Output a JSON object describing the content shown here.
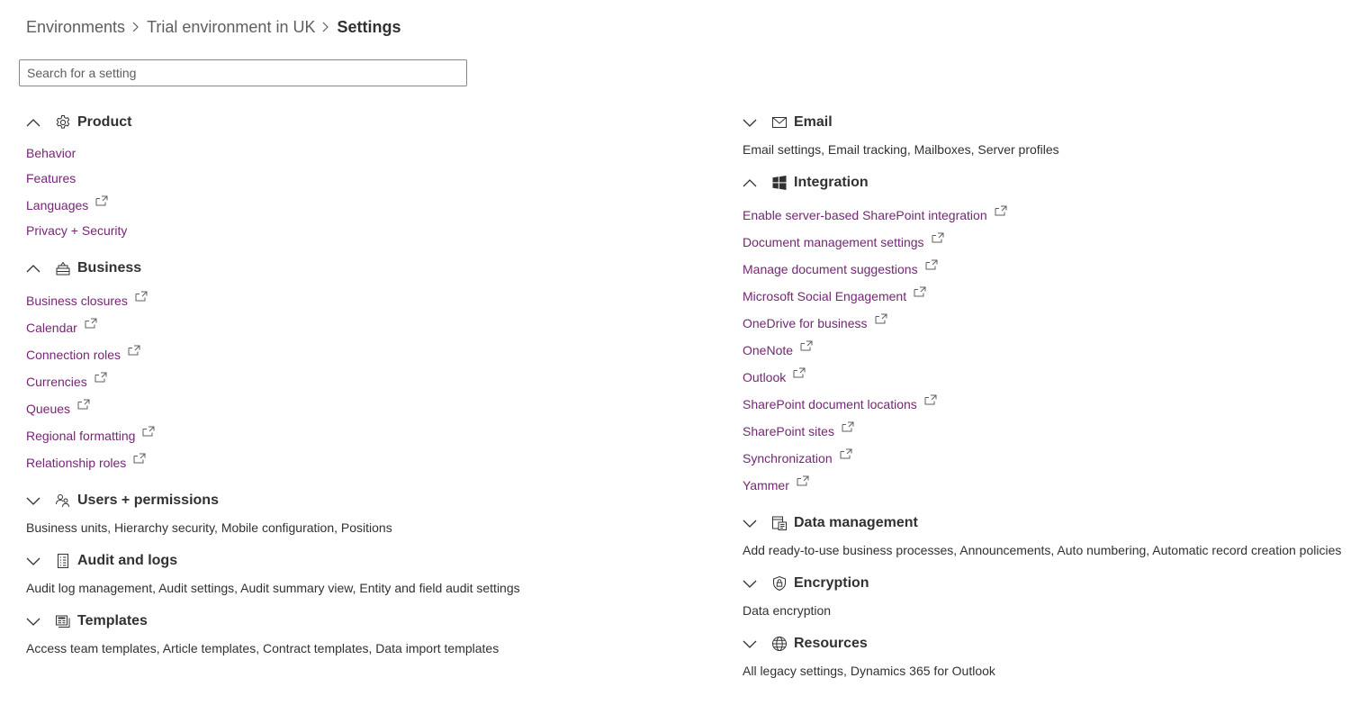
{
  "breadcrumb": {
    "items": [
      "Environments",
      "Trial environment in UK",
      "Settings"
    ]
  },
  "search": {
    "placeholder": "Search for a setting"
  },
  "left_groups": {
    "product": {
      "title": "Product",
      "icon": "gear-icon",
      "expanded": true,
      "links": [
        "Behavior",
        "Features",
        "Languages",
        "Privacy + Security"
      ],
      "external": [
        false,
        false,
        true,
        false
      ]
    },
    "business": {
      "title": "Business",
      "icon": "building-icon",
      "expanded": true,
      "links": [
        "Business closures",
        "Calendar",
        "Connection roles",
        "Currencies",
        "Queues",
        "Regional formatting",
        "Relationship roles"
      ]
    },
    "users": {
      "title": "Users + permissions",
      "icon": "people-icon",
      "expanded": false,
      "summary": "Business units, Hierarchy security, Mobile configuration, Positions"
    },
    "audit": {
      "title": "Audit and logs",
      "icon": "checklist-icon",
      "expanded": false,
      "summary": "Audit log management, Audit settings, Audit summary view, Entity and field audit settings"
    },
    "templates": {
      "title": "Templates",
      "icon": "templates-icon",
      "expanded": false,
      "summary": "Access team templates, Article templates, Contract templates, Data import templates"
    }
  },
  "right_groups": {
    "email": {
      "title": "Email",
      "icon": "mail-icon",
      "expanded": false,
      "summary": "Email settings, Email tracking, Mailboxes, Server profiles"
    },
    "integration": {
      "title": "Integration",
      "icon": "windows-icon",
      "expanded": true,
      "links": [
        "Enable server-based SharePoint integration",
        "Document management settings",
        "Manage document suggestions",
        "Microsoft Social Engagement",
        "OneDrive for business",
        "OneNote",
        "Outlook",
        "SharePoint document locations",
        "SharePoint sites",
        "Synchronization",
        "Yammer"
      ]
    },
    "data": {
      "title": "Data management",
      "icon": "data-management-icon",
      "expanded": false,
      "summary": "Add ready-to-use business processes, Announcements, Auto numbering, Automatic record creation policies"
    },
    "encryption": {
      "title": "Encryption",
      "icon": "shield-lock-icon",
      "expanded": false,
      "summary": "Data encryption"
    },
    "resources": {
      "title": "Resources",
      "icon": "globe-icon",
      "expanded": false,
      "summary": "All legacy settings, Dynamics 365 for Outlook"
    }
  },
  "colors": {
    "link": "#742774",
    "text": "#323130",
    "muted": "#605e5c",
    "border": "#8a8886"
  }
}
